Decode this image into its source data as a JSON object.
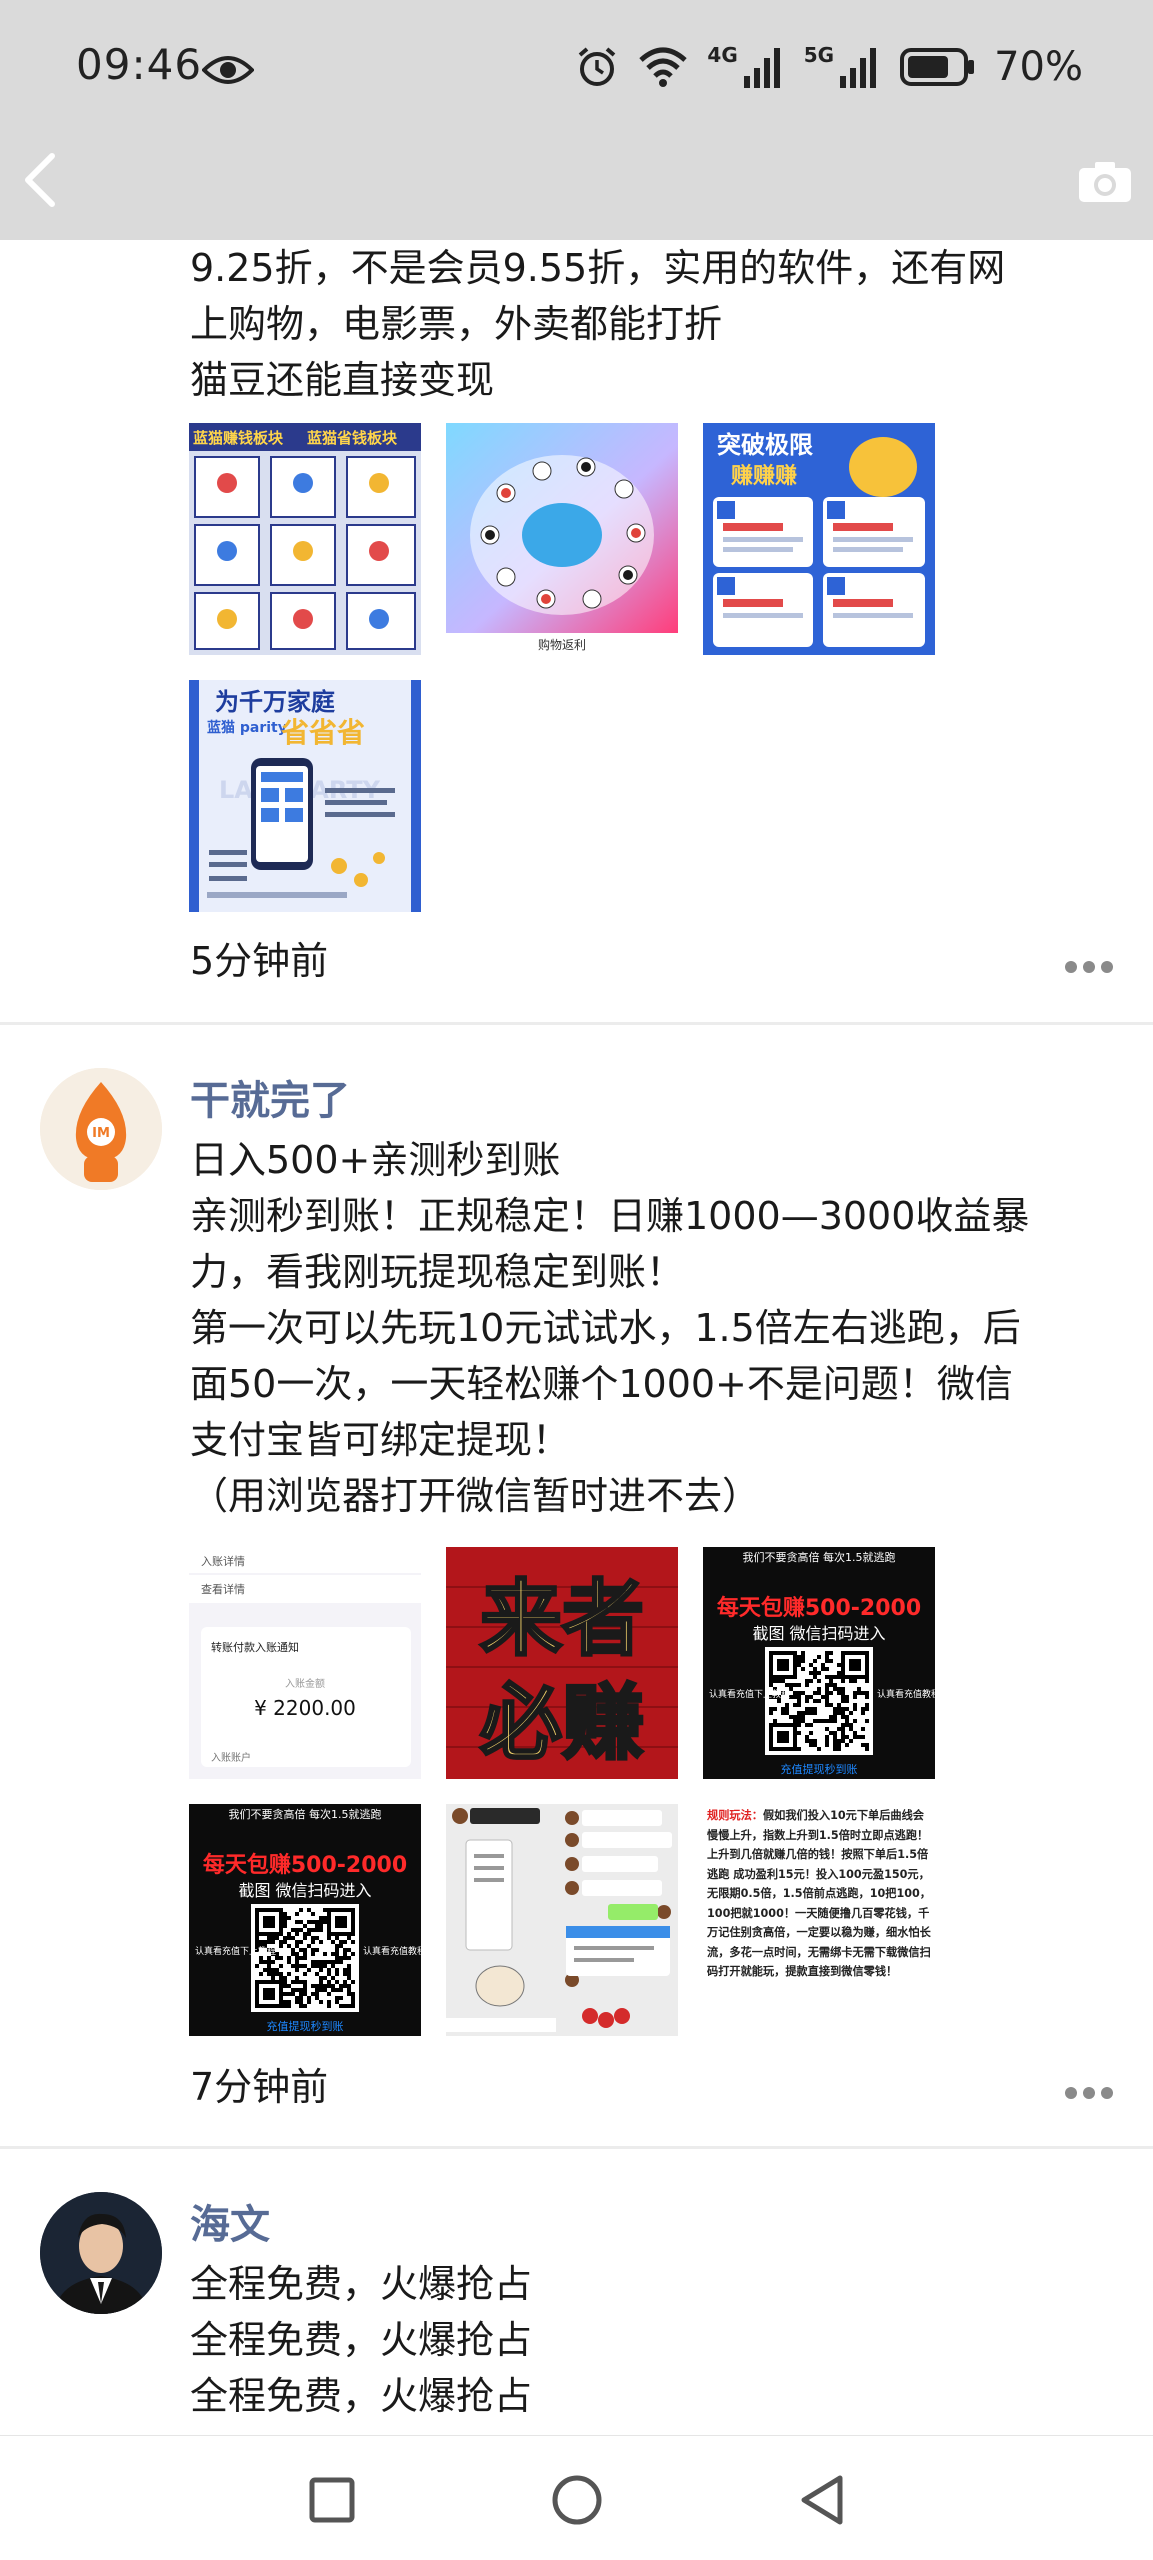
{
  "status_bar": {
    "time": "09:46",
    "net1": "4G",
    "net2": "5G",
    "battery": "70%",
    "icons": [
      "eye-icon",
      "alarm-icon",
      "wifi-icon",
      "signal-icon",
      "battery-icon"
    ]
  },
  "header": {
    "back_icon": "chevron-left-icon",
    "camera_icon": "camera-icon"
  },
  "post1": {
    "text_lines": [
      "9.25折，不是会员9.55折，实用的软件，还有网",
      "上购物，电影票，外卖都能打折",
      "猫豆还能直接变现"
    ],
    "img_labels": {
      "a1": "蓝猫赚钱板块",
      "a2": "蓝猫省钱板块",
      "b_caption": "购物返利",
      "c1": "突破极限",
      "c2": "赚赚赚",
      "d1": "为千万家庭",
      "d2": "省省省",
      "d3": "LAST PARTY",
      "d4": "蓝猫 parity"
    },
    "time_ago": "5分钟前"
  },
  "post2": {
    "username": "干就完了",
    "avatar_text": "IM",
    "text_lines": [
      "日入500+亲测秒到账",
      "亲测秒到账！正规稳定！日赚1000—3000收益暴",
      "力，看我刚玩提现稳定到账！",
      "第一次可以先玩10元试试水，1.5倍左右逃跑，后",
      "面50一次，一天轻松赚个1000+不是问题！微信",
      "支付宝皆可绑定提现！",
      "（用浏览器打开微信暂时进不去）"
    ],
    "img_labels": {
      "p1_row1": "入账详情",
      "p1_row2": "查看详情",
      "p1_title": "转账付款入账通知",
      "p1_label": "入账金额",
      "p1_amount": "¥ 2200.00",
      "p1_foot": "入账账户",
      "p2_line1": "来者",
      "p2_line2": "必赚",
      "p3_top": "我们不要贪高倍 每次1.5就逃跑",
      "p3_red": "每天包赚500-2000",
      "p3_sub": "截图 微信扫码进入",
      "p3_left": "认真看充值下上教程",
      "p3_right": "认真看充值教程",
      "p3_foot": "充值提现秒到账",
      "p6_title": "规则玩法：",
      "p6_body": "假如我们投入10元下单后曲线会慢慢上升，指数上升到1.5倍时立即点逃跑！上升到几倍就赚几倍的钱！按照下单后1.5倍逃跑 成功盈利15元！投入100元盈150元，无限期0.5倍，1.5倍前点逃跑，10把100，100把就1000！一天随便撸几百零花钱，千万记住别贪高倍，一定要以稳为赚，细水怕长流，多花一点时间，无需绑卡无需下载微信扫码打开就能玩，提款直接到微信零钱！"
    },
    "time_ago": "7分钟前"
  },
  "post3": {
    "username": "海文",
    "text_lines": [
      "全程免费，火爆抢占",
      "全程免费，火爆抢占",
      "全程免费，火爆抢占"
    ]
  },
  "navbar": {
    "icons": [
      "square-icon",
      "circle-icon",
      "triangle-back-icon"
    ]
  }
}
